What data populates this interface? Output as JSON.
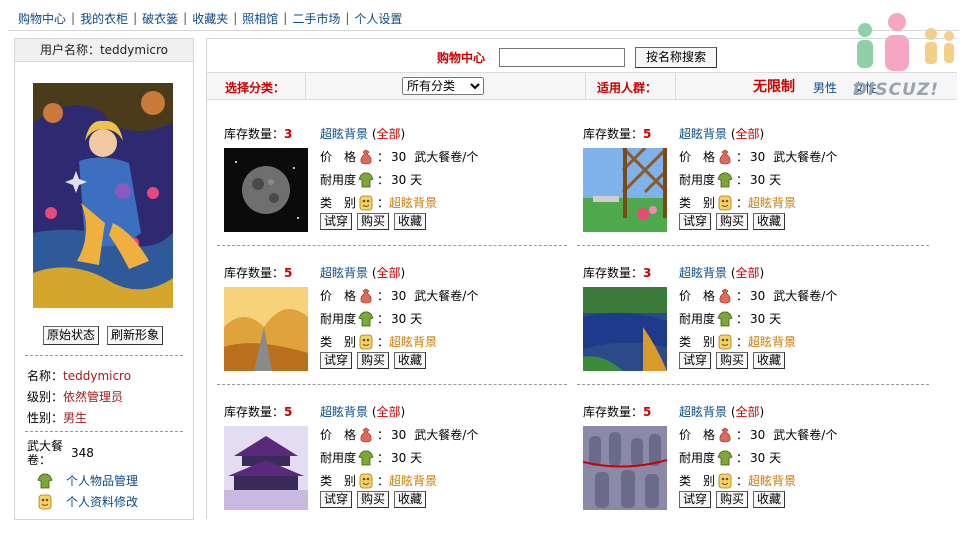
{
  "nav": {
    "items": [
      "购物中心",
      "我的衣柜",
      "破衣篓",
      "收藏夹",
      "照相馆",
      "二手市场",
      "个人设置"
    ],
    "sep": "|"
  },
  "sidebar": {
    "username_label": "用户名称：teddymicro",
    "buttons": {
      "reset": "原始状态",
      "refresh": "刷新形象"
    },
    "info": [
      {
        "k": "名称：",
        "v": "teddymicro"
      },
      {
        "k": "级别：",
        "v": "依然管理员"
      },
      {
        "k": "性别：",
        "v": "男生"
      }
    ],
    "currency": {
      "label": "武大餐卷：",
      "value": "348"
    },
    "menu": [
      {
        "label": "个人物品管理",
        "icon": "shirt-icon"
      },
      {
        "label": "个人资料修改",
        "icon": "mask-icon"
      }
    ]
  },
  "search": {
    "title": "购物中心",
    "input_value": "",
    "input_placeholder": "",
    "button": "按名称搜索"
  },
  "filter": {
    "category_label": "选择分类：",
    "category_selected": "所有分类",
    "audience_label": "适用人群：",
    "unlimited": "无限制",
    "male": "男性",
    "female": "女性"
  },
  "labels": {
    "stock": "库存数量：",
    "price_k": "价　格",
    "durability_k": "耐用度",
    "type_k": "类　别",
    "colon": "：",
    "all_open": "(",
    "all": "全部",
    "all_close": ")",
    "try": "试穿",
    "buy": "购买",
    "fav": "收藏"
  },
  "items": [
    {
      "stock": "3",
      "category": "超眩背景",
      "price": "30",
      "currency": "武大餐卷/个",
      "durability": "30 天",
      "type": "超眩背景",
      "thumb": "moon"
    },
    {
      "stock": "5",
      "category": "超眩背景",
      "price": "30",
      "currency": "武大餐卷/个",
      "durability": "30 天",
      "type": "超眩背景",
      "thumb": "garden"
    },
    {
      "stock": "5",
      "category": "超眩背景",
      "price": "30",
      "currency": "武大餐卷/个",
      "durability": "30 天",
      "type": "超眩背景",
      "thumb": "autumn"
    },
    {
      "stock": "3",
      "category": "超眩背景",
      "price": "30",
      "currency": "武大餐卷/个",
      "durability": "30 天",
      "type": "超眩背景",
      "thumb": "river"
    },
    {
      "stock": "5",
      "category": "超眩背景",
      "price": "30",
      "currency": "武大餐卷/个",
      "durability": "30 天",
      "type": "超眩背景",
      "thumb": "temple"
    },
    {
      "stock": "5",
      "category": "超眩背景",
      "price": "30",
      "currency": "武大餐卷/个",
      "durability": "30 天",
      "type": "超眩背景",
      "thumb": "warriors"
    }
  ],
  "logo_text": "DISCUZ!",
  "colors": {
    "accent_red": "#cc0000",
    "link_blue": "#0a4a8a",
    "category_orange": "#cc7a00"
  }
}
